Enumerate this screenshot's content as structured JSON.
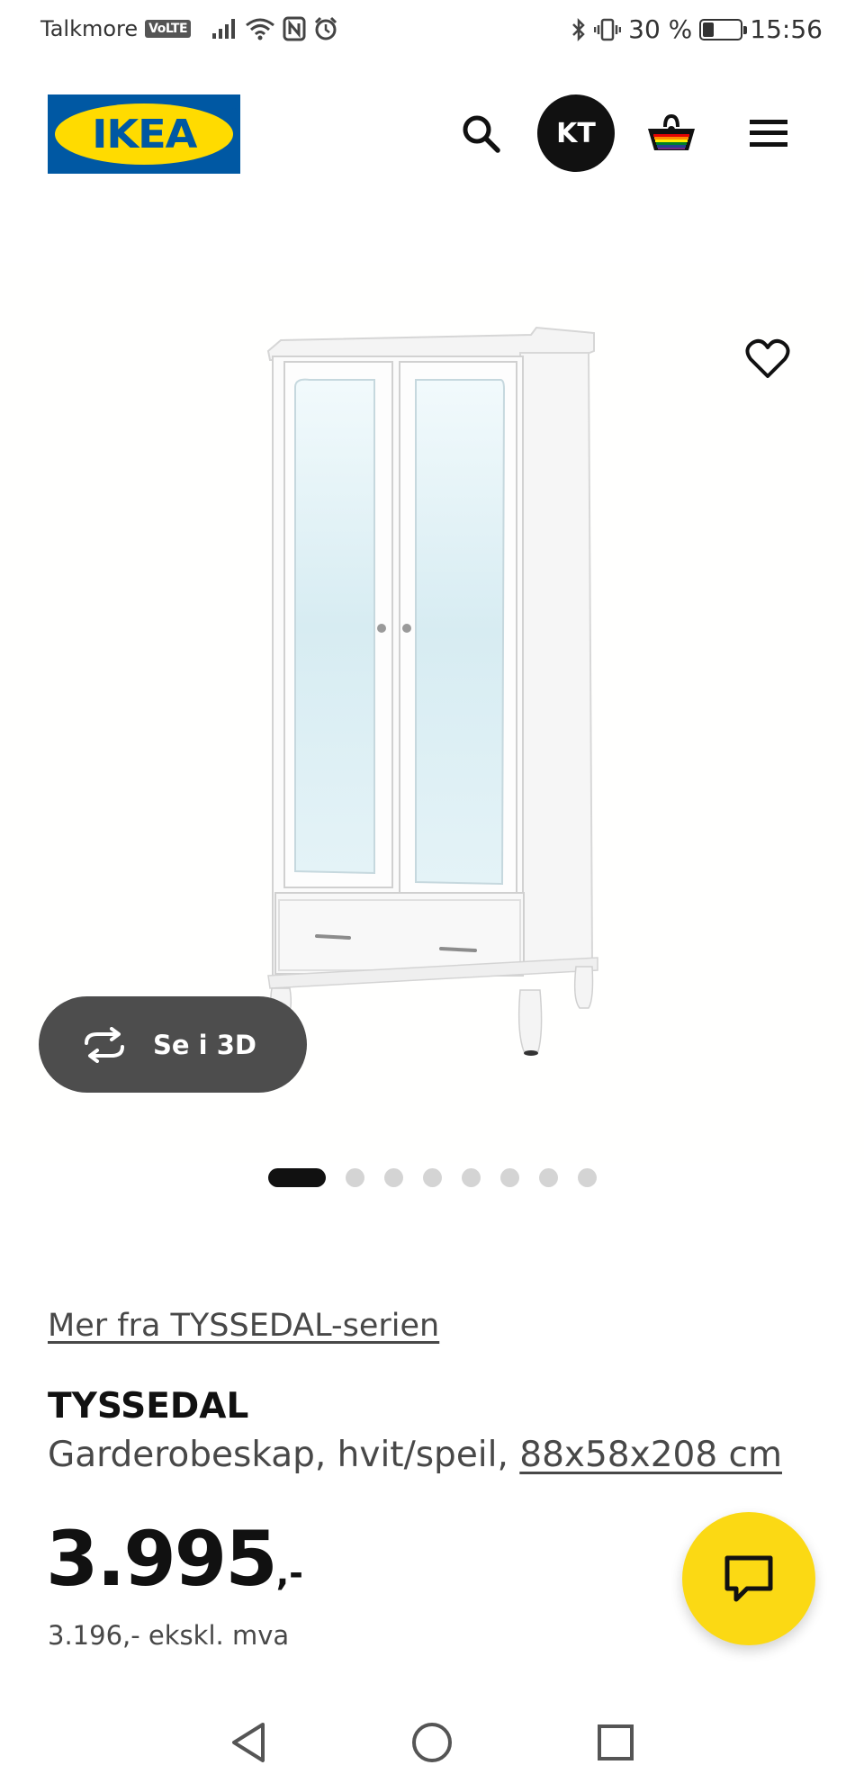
{
  "status_bar": {
    "carrier": "Talkmore",
    "volte": "VoLTE",
    "battery_percent": "30 %",
    "battery_level": 0.3,
    "time": "15:56"
  },
  "header": {
    "logo_text": "IKEA",
    "avatar_initials": "KT",
    "icons": [
      "search-icon",
      "cart-icon",
      "menu-icon"
    ]
  },
  "gallery": {
    "see_3d_label": "Se i 3D",
    "dot_count": 8,
    "active_dot": 1
  },
  "product": {
    "series_link": "Mer fra TYSSEDAL-serien",
    "name": "TYSSEDAL",
    "description": "Garderobeskap, hvit/speil, ",
    "dimensions": "88x58x208 cm",
    "price_main": "3.995",
    "price_suffix": ",-",
    "price_ex_vat": "3.196,- ekskl. mva"
  },
  "colors": {
    "ikea_blue": "#0058a3",
    "ikea_yellow": "#ffdb00",
    "chat_yellow": "#fbd914"
  }
}
